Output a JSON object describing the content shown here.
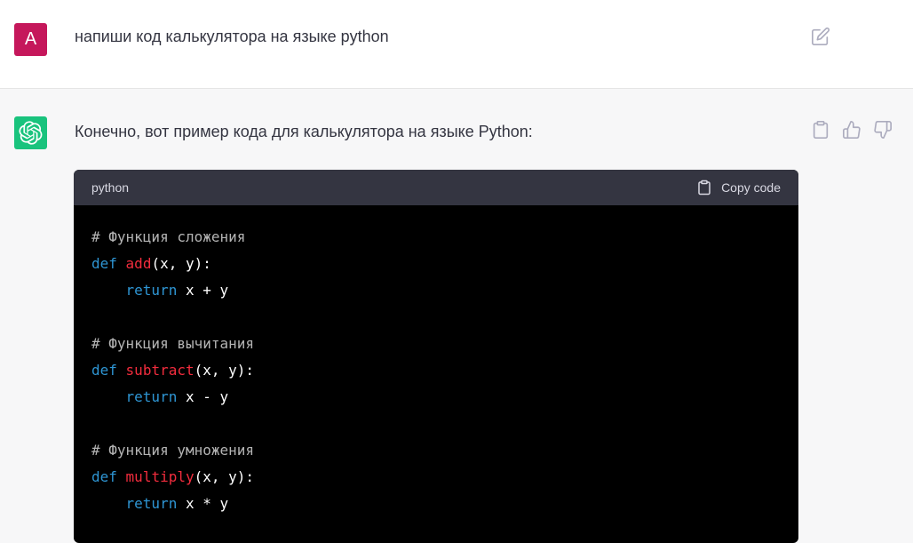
{
  "user": {
    "avatar_letter": "A",
    "message": "напиши код калькулятора на языке python"
  },
  "assistant": {
    "message": "Конечно, вот пример кода для калькулятора на языке Python:",
    "code_block": {
      "language": "python",
      "copy_label": "Copy code",
      "lines": [
        [
          {
            "t": "comment",
            "v": "# Функция сложения"
          }
        ],
        [
          {
            "t": "kw",
            "v": "def"
          },
          {
            "t": "plain",
            "v": " "
          },
          {
            "t": "fn",
            "v": "add"
          },
          {
            "t": "plain",
            "v": "(x, y):"
          }
        ],
        [
          {
            "t": "plain",
            "v": "    "
          },
          {
            "t": "kw",
            "v": "return"
          },
          {
            "t": "plain",
            "v": " x + y"
          }
        ],
        [],
        [
          {
            "t": "comment",
            "v": "# Функция вычитания"
          }
        ],
        [
          {
            "t": "kw",
            "v": "def"
          },
          {
            "t": "plain",
            "v": " "
          },
          {
            "t": "fn",
            "v": "subtract"
          },
          {
            "t": "plain",
            "v": "(x, y):"
          }
        ],
        [
          {
            "t": "plain",
            "v": "    "
          },
          {
            "t": "kw",
            "v": "return"
          },
          {
            "t": "plain",
            "v": " x - y"
          }
        ],
        [],
        [
          {
            "t": "comment",
            "v": "# Функция умножения"
          }
        ],
        [
          {
            "t": "kw",
            "v": "def"
          },
          {
            "t": "plain",
            "v": " "
          },
          {
            "t": "fn",
            "v": "multiply"
          },
          {
            "t": "plain",
            "v": "(x, y):"
          }
        ],
        [
          {
            "t": "plain",
            "v": "    "
          },
          {
            "t": "kw",
            "v": "return"
          },
          {
            "t": "plain",
            "v": " x * y"
          }
        ]
      ]
    }
  },
  "icons": {
    "edit": "edit-icon",
    "copy": "clipboard-icon",
    "thumbs_up": "thumbs-up-icon",
    "thumbs_down": "thumbs-down-icon",
    "assistant_logo": "openai-logo-icon"
  },
  "colors": {
    "user_avatar": "#c5175b",
    "assistant_avatar": "#19c37d",
    "code_header": "#343541",
    "code_bg": "#000000",
    "keyword": "#2e95d3",
    "function_name": "#f22c3d",
    "comment": "#b4b4b4"
  }
}
